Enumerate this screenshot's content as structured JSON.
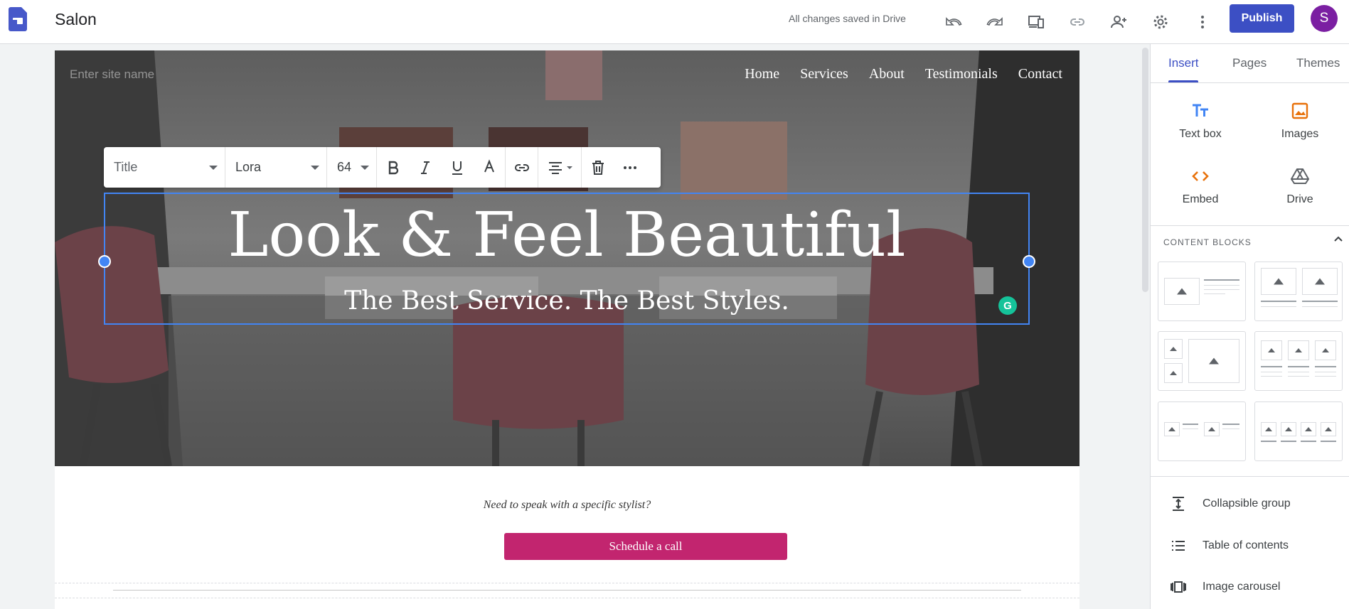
{
  "app": {
    "title": "Salon",
    "save_status": "All changes saved in Drive",
    "publish_label": "Publish",
    "avatar_initial": "S"
  },
  "toolbar_icons": [
    "undo-icon",
    "redo-icon",
    "preview-icon",
    "link-icon",
    "share-icon",
    "gear-icon",
    "more-vert-icon"
  ],
  "site": {
    "name_placeholder": "Enter site name",
    "nav": [
      "Home",
      "Services",
      "About",
      "Testimonials",
      "Contact"
    ],
    "headline": "Look & Feel Beautiful",
    "subheadline": "The Best Service. The Best Styles.",
    "cta_text": "Need to speak with a specific stylist?",
    "cta_button": "Schedule a call"
  },
  "format_toolbar": {
    "style": "Title",
    "font": "Lora",
    "size": "64"
  },
  "panel": {
    "tabs": [
      "Insert",
      "Pages",
      "Themes"
    ],
    "active_tab": "Insert",
    "tools": [
      {
        "label": "Text box",
        "icon": "text-box-icon"
      },
      {
        "label": "Images",
        "icon": "image-icon"
      },
      {
        "label": "Embed",
        "icon": "embed-icon"
      },
      {
        "label": "Drive",
        "icon": "drive-icon"
      }
    ],
    "content_blocks_header": "CONTENT BLOCKS",
    "items": [
      {
        "label": "Collapsible group",
        "icon": "collapsible-icon"
      },
      {
        "label": "Table of contents",
        "icon": "toc-icon"
      },
      {
        "label": "Image carousel",
        "icon": "carousel-icon"
      }
    ]
  },
  "colors": {
    "accent": "#3c4fc4",
    "cta": "#c2256f",
    "selection": "#4285f4",
    "avatar": "#7b1fa2"
  }
}
